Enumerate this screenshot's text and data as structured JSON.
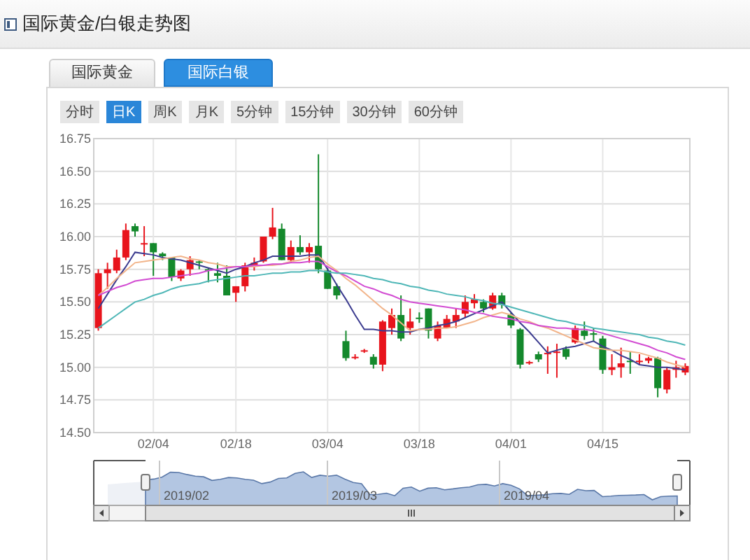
{
  "header": {
    "title": "国际黄金/白银走势图"
  },
  "tabs": [
    {
      "label": "国际黄金",
      "selected": false
    },
    {
      "label": "国际白银",
      "selected": true
    }
  ],
  "periods": [
    {
      "label": "分时",
      "selected": false
    },
    {
      "label": "日K",
      "selected": true
    },
    {
      "label": "周K",
      "selected": false
    },
    {
      "label": "月K",
      "selected": false
    },
    {
      "label": "5分钟",
      "selected": false
    },
    {
      "label": "15分钟",
      "selected": false
    },
    {
      "label": "30分钟",
      "selected": false
    },
    {
      "label": "60分钟",
      "selected": false
    }
  ],
  "chart": {
    "chart_data": {
      "type": "candlestick",
      "grid": true,
      "ylim": [
        14.5,
        16.75
      ],
      "yticks": [
        {
          "value": 14.5,
          "label": "14.50"
        },
        {
          "value": 14.75,
          "label": "14.75"
        },
        {
          "value": 15,
          "label": "15.00"
        },
        {
          "value": 15.25,
          "label": "15.25"
        },
        {
          "value": 15.5,
          "label": "15.50"
        },
        {
          "value": 15.75,
          "label": "15.75"
        },
        {
          "value": 16,
          "label": "16.00"
        },
        {
          "value": 16.25,
          "label": "16.25"
        },
        {
          "value": 16.5,
          "label": "16.50"
        },
        {
          "value": 16.75,
          "label": "16.75"
        }
      ],
      "categories": [
        null,
        null,
        null,
        null,
        null,
        null,
        "02/04",
        null,
        null,
        null,
        null,
        null,
        null,
        null,
        null,
        "02/18",
        null,
        null,
        null,
        null,
        null,
        null,
        null,
        null,
        null,
        "03/04",
        null,
        null,
        null,
        null,
        null,
        null,
        null,
        null,
        null,
        "03/18",
        null,
        null,
        null,
        null,
        null,
        null,
        null,
        null,
        null,
        "04/01",
        null,
        null,
        null,
        null,
        null,
        null,
        null,
        null,
        null,
        "04/15",
        null,
        null,
        null,
        null,
        null,
        null,
        null,
        null,
        null
      ],
      "ohlc": [
        [
          15.3,
          15.75,
          15.28,
          15.72
        ],
        [
          15.72,
          15.8,
          15.6,
          15.75
        ],
        [
          15.74,
          15.9,
          15.72,
          15.84
        ],
        [
          15.84,
          16.1,
          15.82,
          16.05
        ],
        [
          16.08,
          16.1,
          16.0,
          16.04
        ],
        [
          15.95,
          16.08,
          15.85,
          15.95
        ],
        [
          15.95,
          15.95,
          15.7,
          15.88
        ],
        [
          15.87,
          15.88,
          15.82,
          15.85
        ],
        [
          15.84,
          15.84,
          15.66,
          15.69
        ],
        [
          15.68,
          15.75,
          15.66,
          15.74
        ],
        [
          15.75,
          15.85,
          15.7,
          15.82
        ],
        [
          15.81,
          15.82,
          15.75,
          15.8
        ],
        [
          15.75,
          15.76,
          15.65,
          15.74
        ],
        [
          15.72,
          15.8,
          15.65,
          15.7
        ],
        [
          15.7,
          15.78,
          15.55,
          15.55
        ],
        [
          15.57,
          15.62,
          15.5,
          15.62
        ],
        [
          15.62,
          15.8,
          15.58,
          15.78
        ],
        [
          15.78,
          15.84,
          15.74,
          15.8
        ],
        [
          15.81,
          16.0,
          15.8,
          16.0
        ],
        [
          16.0,
          16.22,
          15.98,
          16.07
        ],
        [
          16.06,
          16.1,
          15.82,
          15.82
        ],
        [
          15.82,
          15.97,
          15.8,
          15.92
        ],
        [
          15.92,
          16.01,
          15.86,
          15.88
        ],
        [
          15.88,
          15.95,
          15.8,
          15.92
        ],
        [
          15.93,
          16.63,
          15.72,
          15.75
        ],
        [
          15.74,
          15.76,
          15.6,
          15.6
        ],
        [
          15.62,
          15.64,
          15.52,
          15.55
        ],
        [
          15.2,
          15.28,
          15.05,
          15.07
        ],
        [
          15.08,
          15.1,
          15.06,
          15.08
        ],
        [
          15.12,
          15.14,
          15.11,
          15.13
        ],
        [
          15.08,
          15.1,
          14.99,
          15.02
        ],
        [
          15.02,
          15.36,
          14.97,
          15.35
        ],
        [
          15.3,
          15.45,
          15.25,
          15.4
        ],
        [
          15.4,
          15.55,
          15.2,
          15.22
        ],
        [
          15.3,
          15.45,
          15.25,
          15.35
        ],
        [
          15.38,
          15.42,
          15.34,
          15.37
        ],
        [
          15.45,
          15.45,
          15.22,
          15.28
        ],
        [
          15.22,
          15.35,
          15.2,
          15.32
        ],
        [
          15.3,
          15.4,
          15.3,
          15.37
        ],
        [
          15.35,
          15.45,
          15.3,
          15.4
        ],
        [
          15.41,
          15.55,
          15.38,
          15.5
        ],
        [
          15.49,
          15.56,
          15.45,
          15.52
        ],
        [
          15.5,
          15.52,
          15.42,
          15.45
        ],
        [
          15.45,
          15.57,
          15.44,
          15.55
        ],
        [
          15.55,
          15.57,
          15.45,
          15.48
        ],
        [
          15.4,
          15.42,
          15.3,
          15.32
        ],
        [
          15.29,
          15.3,
          14.99,
          15.02
        ],
        [
          15.03,
          15.05,
          15.02,
          15.04
        ],
        [
          15.1,
          15.12,
          15.04,
          15.06
        ],
        [
          15.1,
          15.16,
          14.95,
          15.11
        ],
        [
          15.12,
          15.18,
          14.92,
          15.12
        ],
        [
          15.14,
          15.16,
          15.06,
          15.08
        ],
        [
          15.19,
          15.32,
          15.18,
          15.3
        ],
        [
          15.28,
          15.35,
          15.21,
          15.24
        ],
        [
          15.26,
          15.3,
          15.2,
          15.25
        ],
        [
          15.22,
          15.24,
          14.95,
          14.98
        ],
        [
          14.98,
          15.1,
          14.94,
          15.0
        ],
        [
          15.0,
          15.15,
          14.92,
          15.03
        ],
        [
          15.05,
          15.12,
          14.95,
          15.04
        ],
        [
          15.04,
          15.1,
          15.02,
          15.05
        ],
        [
          15.05,
          15.08,
          15.03,
          15.07
        ],
        [
          15.07,
          15.08,
          14.77,
          14.84
        ],
        [
          14.83,
          15.0,
          14.8,
          14.98
        ],
        [
          14.98,
          15.05,
          14.92,
          15.0
        ],
        [
          14.96,
          15.03,
          14.94,
          15.01
        ]
      ]
    },
    "moving_averages": {
      "chart_data": {
        "type": "line",
        "ylim": [
          14.5,
          16.75
        ],
        "series": [
          {
            "color": "#3b3b8f",
            "values": [
              15.45,
              15.56,
              15.67,
              15.77,
              15.88,
              15.87,
              15.86,
              15.84,
              15.83,
              15.82,
              15.8,
              15.78,
              15.76,
              15.74,
              15.72,
              15.75,
              15.77,
              15.8,
              15.82,
              15.85,
              15.85,
              15.85,
              15.85,
              15.86,
              15.86,
              15.75,
              15.63,
              15.52,
              15.4,
              15.29,
              15.29,
              15.28,
              15.28,
              15.27,
              15.27,
              15.29,
              15.3,
              15.32,
              15.33,
              15.35,
              15.38,
              15.41,
              15.44,
              15.47,
              15.5,
              15.42,
              15.34,
              15.27,
              15.19,
              15.11,
              15.13,
              15.15,
              15.16,
              15.18,
              15.2,
              15.16,
              15.13,
              15.09,
              15.06,
              15.02,
              15.01,
              15.0,
              15.0,
              14.99,
              14.98
            ]
          },
          {
            "color": "#f2b48a",
            "values": [
              15.55,
              15.61,
              15.68,
              15.74,
              15.8,
              15.81,
              15.82,
              15.83,
              15.84,
              15.85,
              15.83,
              15.82,
              15.8,
              15.79,
              15.77,
              15.77,
              15.77,
              15.77,
              15.78,
              15.78,
              15.79,
              15.81,
              15.82,
              15.84,
              15.85,
              15.79,
              15.74,
              15.68,
              15.63,
              15.57,
              15.51,
              15.45,
              15.4,
              15.34,
              15.28,
              15.29,
              15.29,
              15.3,
              15.3,
              15.31,
              15.33,
              15.35,
              15.38,
              15.4,
              15.42,
              15.4,
              15.37,
              15.35,
              15.32,
              15.3,
              15.27,
              15.24,
              15.21,
              15.18,
              15.15,
              15.14,
              15.13,
              15.13,
              15.12,
              15.11,
              15.09,
              15.07,
              15.04,
              15.02,
              15.0
            ]
          },
          {
            "color": "#d24bd2",
            "values": [
              15.55,
              15.58,
              15.61,
              15.63,
              15.66,
              15.67,
              15.68,
              15.68,
              15.69,
              15.7,
              15.71,
              15.72,
              15.74,
              15.75,
              15.76,
              15.77,
              15.77,
              15.78,
              15.78,
              15.79,
              15.79,
              15.8,
              15.8,
              15.81,
              15.81,
              15.77,
              15.73,
              15.7,
              15.66,
              15.62,
              15.6,
              15.57,
              15.55,
              15.52,
              15.5,
              15.49,
              15.48,
              15.47,
              15.46,
              15.45,
              15.44,
              15.42,
              15.41,
              15.39,
              15.38,
              15.37,
              15.35,
              15.34,
              15.32,
              15.31,
              15.3,
              15.3,
              15.29,
              15.29,
              15.28,
              15.26,
              15.24,
              15.22,
              15.2,
              15.18,
              15.16,
              15.13,
              15.11,
              15.08,
              15.06
            ]
          },
          {
            "color": "#4fb7b7",
            "values": [
              15.3,
              15.35,
              15.4,
              15.45,
              15.5,
              15.52,
              15.55,
              15.57,
              15.6,
              15.62,
              15.63,
              15.64,
              15.66,
              15.67,
              15.68,
              15.69,
              15.7,
              15.7,
              15.71,
              15.72,
              15.72,
              15.73,
              15.73,
              15.74,
              15.74,
              15.73,
              15.72,
              15.72,
              15.71,
              15.7,
              15.68,
              15.67,
              15.65,
              15.64,
              15.62,
              15.61,
              15.59,
              15.58,
              15.56,
              15.55,
              15.54,
              15.52,
              15.51,
              15.49,
              15.48,
              15.46,
              15.44,
              15.42,
              15.4,
              15.38,
              15.36,
              15.35,
              15.33,
              15.32,
              15.3,
              15.29,
              15.28,
              15.27,
              15.26,
              15.25,
              15.23,
              15.22,
              15.2,
              15.19,
              15.17
            ]
          }
        ]
      }
    }
  },
  "navigator": {
    "labels": [
      "2019/02",
      "2019/03",
      "2019/04"
    ]
  }
}
